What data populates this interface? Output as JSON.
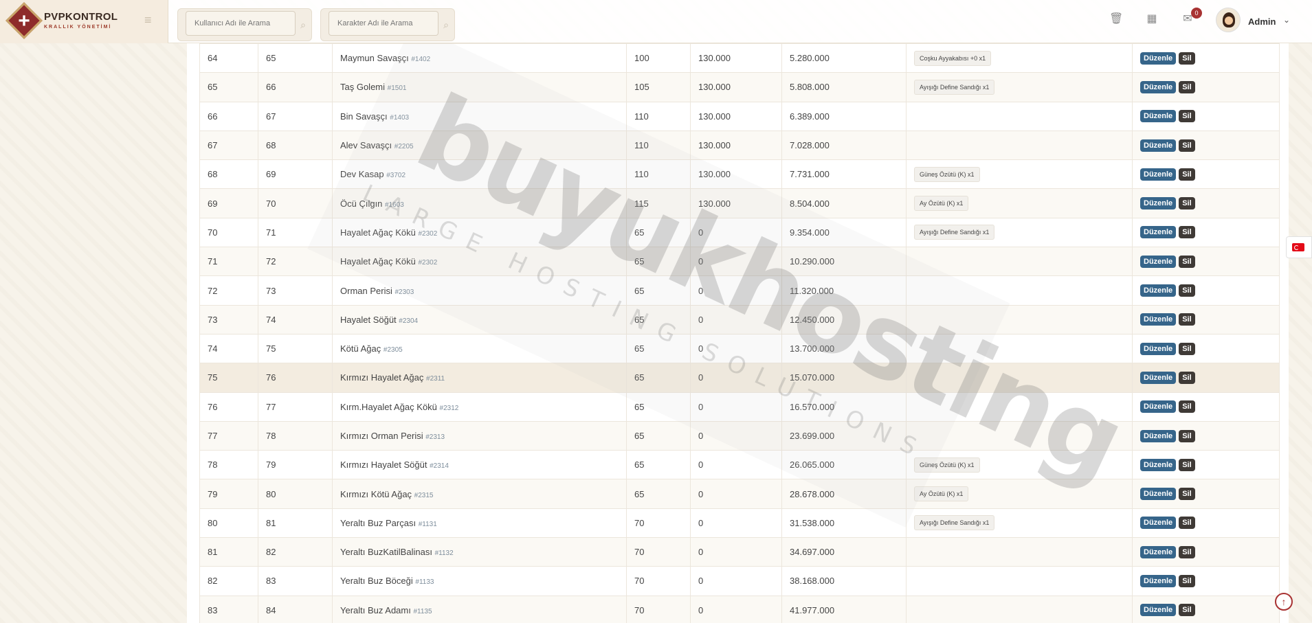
{
  "brand": {
    "name": "PVPKONTROL",
    "subtitle": "KRALLIK YÖNETİMİ"
  },
  "search": {
    "user_placeholder": "Kullanıcı Adı ile Arama",
    "char_placeholder": "Karakter Adı ile Arama"
  },
  "header": {
    "notifications_count": "0",
    "admin_label": "Admin",
    "icons": [
      "trash-icon",
      "calendar-icon",
      "mail-icon"
    ]
  },
  "table": {
    "edit_label": "Düzenle",
    "delete_label": "Sil",
    "rows": [
      {
        "no": "64",
        "level": "65",
        "mob": "Maymun Savaşçı",
        "mob_id": "#1402",
        "count": "100",
        "gold": "130.000",
        "exp": "5.280.000",
        "reward": "Coşku Ayyakabısı +0 x1"
      },
      {
        "no": "65",
        "level": "66",
        "mob": "Taş Golemi",
        "mob_id": "#1501",
        "count": "105",
        "gold": "130.000",
        "exp": "5.808.000",
        "reward": "Ayışığı Define Sandığı x1"
      },
      {
        "no": "66",
        "level": "67",
        "mob": "Bin Savaşçı",
        "mob_id": "#1403",
        "count": "110",
        "gold": "130.000",
        "exp": "6.389.000",
        "reward": ""
      },
      {
        "no": "67",
        "level": "68",
        "mob": "Alev Savaşçı",
        "mob_id": "#2205",
        "count": "110",
        "gold": "130.000",
        "exp": "7.028.000",
        "reward": ""
      },
      {
        "no": "68",
        "level": "69",
        "mob": "Dev Kasap",
        "mob_id": "#3702",
        "count": "110",
        "gold": "130.000",
        "exp": "7.731.000",
        "reward": "Güneş Özütü (K) x1"
      },
      {
        "no": "69",
        "level": "70",
        "mob": "Öcü Çılgın",
        "mob_id": "#1603",
        "count": "115",
        "gold": "130.000",
        "exp": "8.504.000",
        "reward": "Ay Özütü (K) x1"
      },
      {
        "no": "70",
        "level": "71",
        "mob": "Hayalet Ağaç Kökü",
        "mob_id": "#2302",
        "count": "65",
        "gold": "0",
        "exp": "9.354.000",
        "reward": "Ayışığı Define Sandığı x1"
      },
      {
        "no": "71",
        "level": "72",
        "mob": "Hayalet Ağaç Kökü",
        "mob_id": "#2302",
        "count": "65",
        "gold": "0",
        "exp": "10.290.000",
        "reward": ""
      },
      {
        "no": "72",
        "level": "73",
        "mob": "Orman Perisi",
        "mob_id": "#2303",
        "count": "65",
        "gold": "0",
        "exp": "11.320.000",
        "reward": ""
      },
      {
        "no": "73",
        "level": "74",
        "mob": "Hayalet Söğüt",
        "mob_id": "#2304",
        "count": "65",
        "gold": "0",
        "exp": "12.450.000",
        "reward": ""
      },
      {
        "no": "74",
        "level": "75",
        "mob": "Kötü Ağaç",
        "mob_id": "#2305",
        "count": "65",
        "gold": "0",
        "exp": "13.700.000",
        "reward": ""
      },
      {
        "no": "75",
        "level": "76",
        "mob": "Kırmızı Hayalet Ağaç",
        "mob_id": "#2311",
        "count": "65",
        "gold": "0",
        "exp": "15.070.000",
        "reward": ""
      },
      {
        "no": "76",
        "level": "77",
        "mob": "Kırm.Hayalet Ağaç Kökü",
        "mob_id": "#2312",
        "count": "65",
        "gold": "0",
        "exp": "16.570.000",
        "reward": ""
      },
      {
        "no": "77",
        "level": "78",
        "mob": "Kırmızı Orman Perisi",
        "mob_id": "#2313",
        "count": "65",
        "gold": "0",
        "exp": "23.699.000",
        "reward": ""
      },
      {
        "no": "78",
        "level": "79",
        "mob": "Kırmızı Hayalet Söğüt",
        "mob_id": "#2314",
        "count": "65",
        "gold": "0",
        "exp": "26.065.000",
        "reward": "Güneş Özütü (K) x1"
      },
      {
        "no": "79",
        "level": "80",
        "mob": "Kırmızı Kötü Ağaç",
        "mob_id": "#2315",
        "count": "65",
        "gold": "0",
        "exp": "28.678.000",
        "reward": "Ay Özütü (K) x1"
      },
      {
        "no": "80",
        "level": "81",
        "mob": "Yeraltı Buz Parçası",
        "mob_id": "#1131",
        "count": "70",
        "gold": "0",
        "exp": "31.538.000",
        "reward": "Ayışığı Define Sandığı x1"
      },
      {
        "no": "81",
        "level": "82",
        "mob": "Yeraltı BuzKatilBalinası",
        "mob_id": "#1132",
        "count": "70",
        "gold": "0",
        "exp": "34.697.000",
        "reward": ""
      },
      {
        "no": "82",
        "level": "83",
        "mob": "Yeraltı Buz Böceği",
        "mob_id": "#1133",
        "count": "70",
        "gold": "0",
        "exp": "38.168.000",
        "reward": ""
      },
      {
        "no": "83",
        "level": "84",
        "mob": "Yeraltı Buz Adamı",
        "mob_id": "#1135",
        "count": "70",
        "gold": "0",
        "exp": "41.977.000",
        "reward": ""
      }
    ]
  },
  "watermark": {
    "main": "buyukhosting",
    "sub": "LARGE HOSTING SOLUTIONS"
  },
  "language": {
    "flag": "turkey-flag-icon"
  },
  "colors": {
    "edit_button": "#36658a",
    "delete_button": "#3f3a36",
    "brand": "#8e2b2b",
    "badge": "#a83232"
  }
}
